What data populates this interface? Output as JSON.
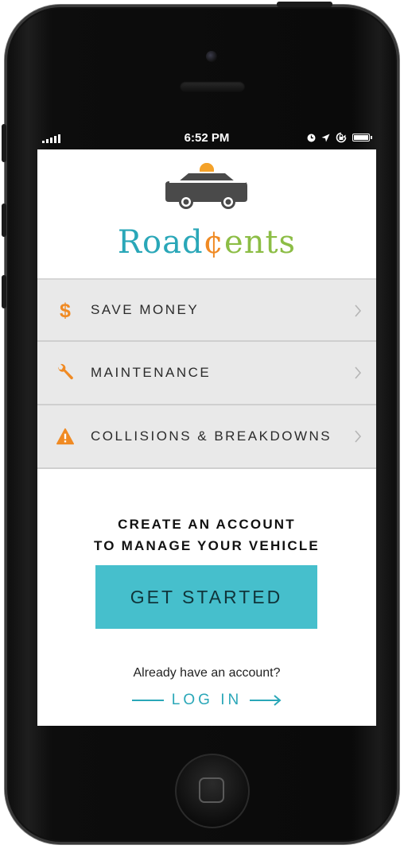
{
  "status_bar": {
    "time": "6:52 PM",
    "icons": [
      "signal-icon",
      "clock-icon",
      "location-arrow-icon",
      "rotation-lock-icon",
      "battery-icon"
    ]
  },
  "brand": {
    "name_part1": "Road",
    "name_cent": "¢",
    "name_part2": "ents",
    "logo_icon": "car-with-coin-icon"
  },
  "menu": {
    "items": [
      {
        "label": "SAVE MONEY",
        "icon": "dollar-icon"
      },
      {
        "label": "MAINTENANCE",
        "icon": "wrench-icon"
      },
      {
        "label": "COLLISIONS & BREAKDOWNS",
        "icon": "warning-icon"
      }
    ]
  },
  "cta": {
    "line1": "CREATE AN ACCOUNT",
    "line2": "TO MANAGE YOUR VEHICLE",
    "button": "GET STARTED"
  },
  "login": {
    "prompt": "Already have an account?",
    "label": "LOG IN"
  },
  "colors": {
    "teal": "#2aa7b8",
    "button": "#46bfcc",
    "orange": "#f08a23",
    "green": "#8cbd45",
    "menu_bg": "#e9e9e9"
  }
}
